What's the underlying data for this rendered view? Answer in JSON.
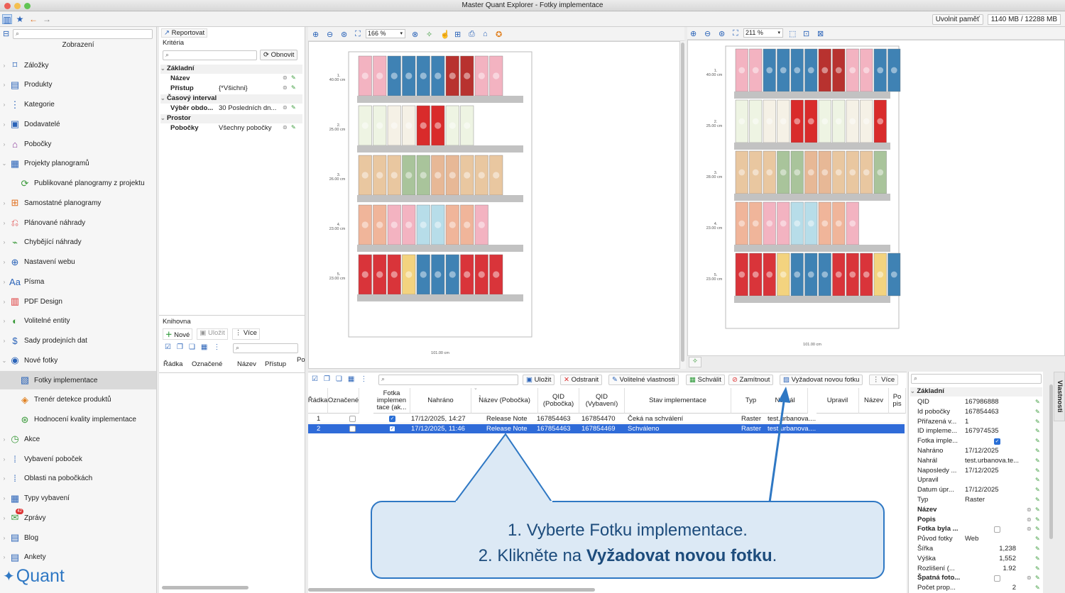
{
  "window": {
    "title": "Master Quant Explorer - Fotky implementace"
  },
  "memory": {
    "button": "Uvolnit paměť",
    "value": "1140 MB / 12288 MB"
  },
  "left": {
    "header": "Zobrazení",
    "items": [
      {
        "label": "Záložky",
        "icon": "bookmark-icon"
      },
      {
        "label": "Produkty",
        "icon": "box-icon"
      },
      {
        "label": "Kategorie",
        "icon": "category-icon"
      },
      {
        "label": "Dodavatelé",
        "icon": "supplier-icon"
      },
      {
        "label": "Pobočky",
        "icon": "store-icon"
      },
      {
        "label": "Projekty planogramů",
        "icon": "project-icon"
      },
      {
        "label": "Publikované planogramy z projektu",
        "icon": "publish-icon"
      },
      {
        "label": "Samostatné planogramy",
        "icon": "planogram-icon"
      },
      {
        "label": "Plánované náhrady",
        "icon": "replace-icon"
      },
      {
        "label": "Chybějící náhrady",
        "icon": "missing-icon"
      },
      {
        "label": "Nastavení webu",
        "icon": "web-icon"
      },
      {
        "label": "Písma",
        "icon": "font-icon"
      },
      {
        "label": "PDF Design",
        "icon": "pdf-icon"
      },
      {
        "label": "Volitelné entity",
        "icon": "entity-icon"
      },
      {
        "label": "Sady prodejních dat",
        "icon": "sales-icon"
      },
      {
        "label": "Nové fotky",
        "icon": "camera-icon"
      },
      {
        "label": "Fotky implementace",
        "icon": "photo-icon"
      },
      {
        "label": "Trenér detekce produktů",
        "icon": "trainer-icon"
      },
      {
        "label": "Hodnocení kvality implementace",
        "icon": "quality-icon"
      },
      {
        "label": "Akce",
        "icon": "action-icon"
      },
      {
        "label": "Vybavení poboček",
        "icon": "equipment-icon"
      },
      {
        "label": "Oblasti na pobočkách",
        "icon": "area-icon"
      },
      {
        "label": "Typy vybavení",
        "icon": "type-icon"
      },
      {
        "label": "Zprávy",
        "icon": "message-icon",
        "badge": "42"
      },
      {
        "label": "Blog",
        "icon": "blog-icon"
      },
      {
        "label": "Ankety",
        "icon": "poll-icon"
      }
    ],
    "logo": "Quant"
  },
  "middle": {
    "report_btn": "Reportovat",
    "criteria_label": "Kritéria",
    "refresh_btn": "Obnovit",
    "groups": [
      {
        "name": "Základní",
        "rows": [
          {
            "k": "Název",
            "v": ""
          },
          {
            "k": "Přístup",
            "v": "{*Všichni}"
          }
        ]
      },
      {
        "name": "Časový interval",
        "rows": [
          {
            "k": "Výběr obdo...",
            "v": "30 Posledních dn..."
          }
        ]
      },
      {
        "name": "Prostor",
        "rows": [
          {
            "k": "Pobočky",
            "v": "Všechny pobočky"
          }
        ]
      }
    ],
    "library_label": "Knihovna",
    "new_btn": "Nové",
    "save_btn": "Uložit",
    "more_btn": "Více",
    "lib_cols": [
      "Řádka",
      "Označené",
      "Název",
      "Přístup",
      "Po"
    ]
  },
  "planogram_left": {
    "zoom": "166 %",
    "width_label": "101.00 cm",
    "shelves": [
      {
        "num": "1.",
        "h": "40.00 cm"
      },
      {
        "num": "2.",
        "h": "25.00 cm"
      },
      {
        "num": "3.",
        "h": "26.00 cm"
      },
      {
        "num": "4.",
        "h": "23.00 cm"
      },
      {
        "num": "5.",
        "h": "23.00 cm"
      }
    ]
  },
  "planogram_right": {
    "zoom": "211 %",
    "width_label": "101.00 cm",
    "shelves": [
      {
        "num": "1.",
        "h": "40.00 cm"
      },
      {
        "num": "2.",
        "h": "25.00 cm"
      },
      {
        "num": "3.",
        "h": "28.00 cm"
      },
      {
        "num": "4.",
        "h": "23.00 cm"
      },
      {
        "num": "5.",
        "h": "23.00 cm"
      }
    ]
  },
  "table": {
    "buttons": {
      "save": "Uložit",
      "remove": "Odstranit",
      "optional": "Volitelné vlastnosti",
      "approve": "Schválit",
      "reject": "Zamítnout",
      "request": "Vyžadovat novou fotku",
      "more": "Více"
    },
    "columns": [
      "Řádka",
      "Označené",
      "Fotka implemen tace (ak...",
      "Nahráno",
      "Název (Pobočka)",
      "QID (Pobočka)",
      "QID (Vybavení)",
      "Stav implementace",
      "Typ",
      "Nahrál",
      "Upravil",
      "Název",
      "Po pis"
    ],
    "sort_index": "1",
    "rows": [
      {
        "row": "1",
        "marked": false,
        "photo": true,
        "uploaded": "17/12/2025, 14:27",
        "store": "Release Note",
        "qid_store": "167854463",
        "qid_eq": "167854470",
        "state": "Čeká na schválení",
        "type": "Raster",
        "by": "test.urbanova....",
        "edited": "",
        "name": ""
      },
      {
        "row": "2",
        "marked": false,
        "photo": true,
        "uploaded": "17/12/2025, 11:46",
        "store": "Release Note",
        "qid_store": "167854463",
        "qid_eq": "167854469",
        "state": "Schváleno",
        "type": "Raster",
        "by": "test.urbanova....",
        "edited": "",
        "name": ""
      }
    ]
  },
  "props": {
    "tab": "Vlastnosti",
    "group": "Základní",
    "rows": [
      {
        "k": "QID",
        "v": "167986888"
      },
      {
        "k": "Id pobočky",
        "v": "167854463"
      },
      {
        "k": "Přiřazená v...",
        "v": "1"
      },
      {
        "k": "ID impleme...",
        "v": "167974535"
      },
      {
        "k": "Fotka imple...",
        "v": "",
        "check": true
      },
      {
        "k": "Nahráno",
        "v": "17/12/2025"
      },
      {
        "k": "Nahrál",
        "v": "test.urbanova.te..."
      },
      {
        "k": "Naposledy ...",
        "v": "17/12/2025"
      },
      {
        "k": "Upravil",
        "v": ""
      },
      {
        "k": "Datum úpr...",
        "v": "17/12/2025"
      },
      {
        "k": "Typ",
        "v": "Raster"
      },
      {
        "k": "Název",
        "v": "",
        "bold": true
      },
      {
        "k": "Popis",
        "v": "",
        "bold": true
      },
      {
        "k": "Fotka byla ...",
        "v": "",
        "bold": true,
        "check": false
      },
      {
        "k": "Původ fotky",
        "v": "Web"
      },
      {
        "k": "Šířka",
        "v": "1,238",
        "right": true
      },
      {
        "k": "Výška",
        "v": "1,552",
        "right": true
      },
      {
        "k": "Rozlišení (...",
        "v": "1.92",
        "right": true
      },
      {
        "k": "Špatná foto...",
        "v": "",
        "bold": true,
        "check": false
      },
      {
        "k": "Počet prop...",
        "v": "2",
        "right": true
      }
    ]
  },
  "callout": {
    "line1": "1. Vyberte Fotku implementace.",
    "line2_prefix": "2. Klikněte na ",
    "line2_bold": "Vyžadovat novou fotku",
    "line2_suffix": "."
  }
}
